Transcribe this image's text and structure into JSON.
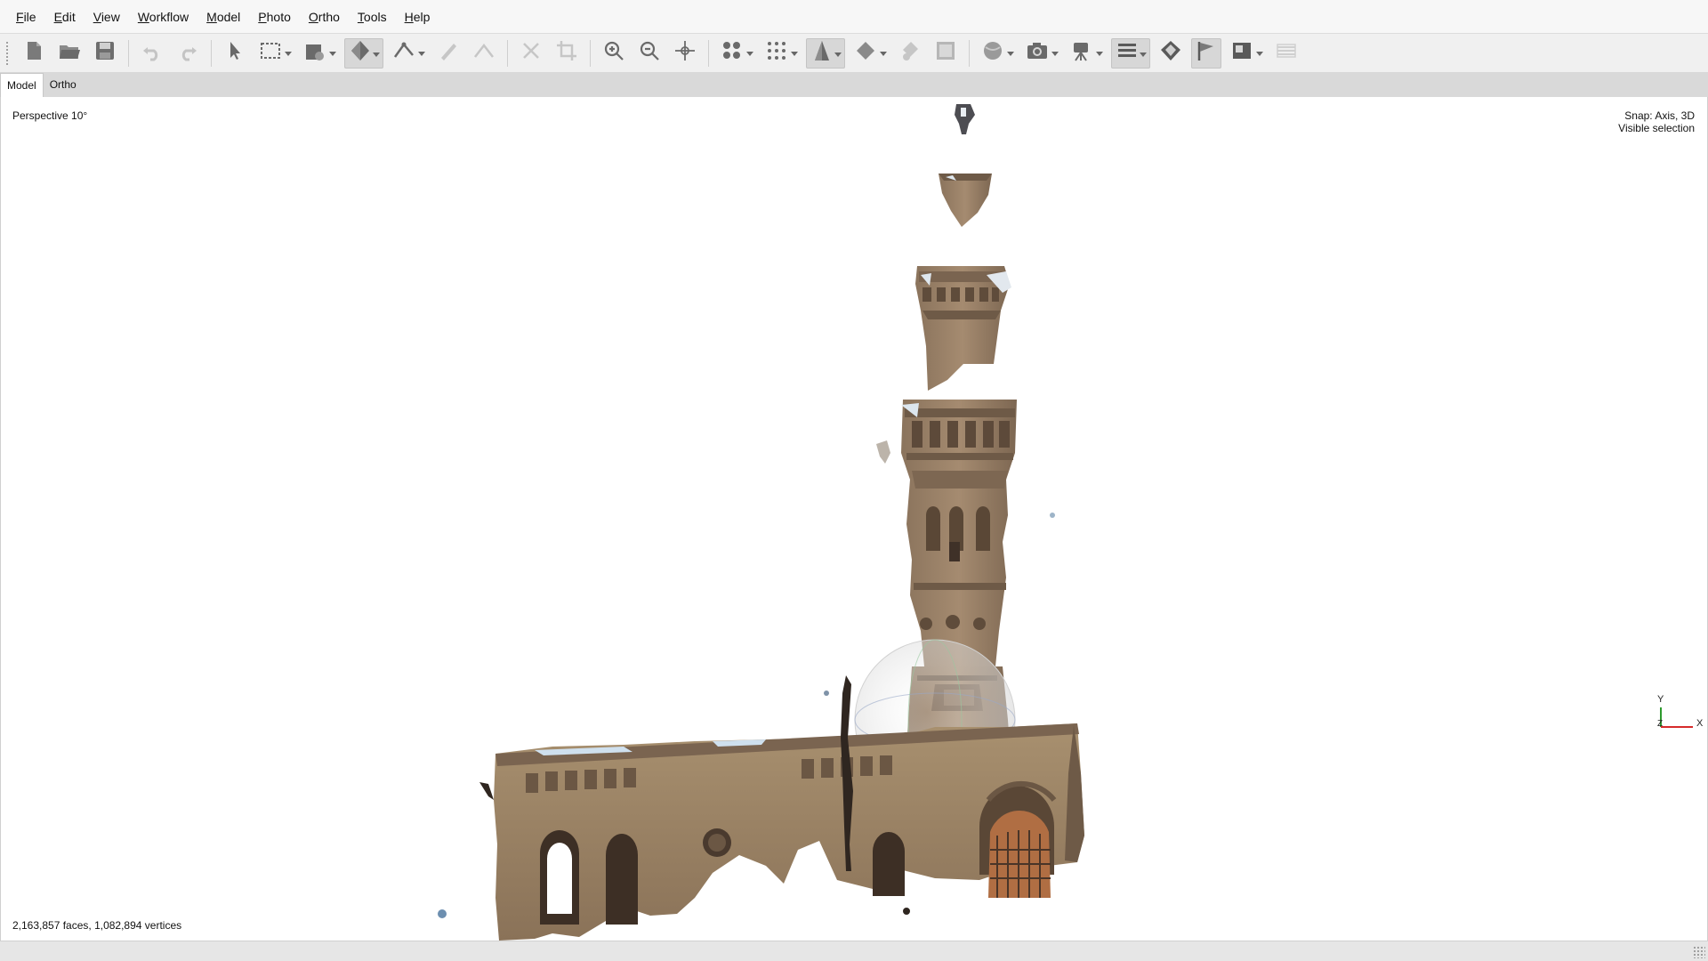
{
  "menu": [
    {
      "key": "F",
      "rest": "ile"
    },
    {
      "key": "E",
      "rest": "dit"
    },
    {
      "key": "V",
      "rest": "iew"
    },
    {
      "key": "W",
      "rest": "orkflow"
    },
    {
      "key": "M",
      "rest": "odel"
    },
    {
      "key": "P",
      "rest": "hoto"
    },
    {
      "key": "O",
      "rest": "rtho"
    },
    {
      "key": "T",
      "rest": "ools"
    },
    {
      "key": "H",
      "rest": "elp"
    }
  ],
  "toolbar_icons": [
    "new-project-icon",
    "open-project-icon",
    "save-project-icon",
    "undo-icon",
    "redo-icon",
    "navigation-arrow-icon",
    "rectangle-selection-icon",
    "draw-shape-icon",
    "model-view-icon",
    "measure-ruler-icon",
    "draw-line-icon",
    "polyline-icon",
    "delete-selection-icon",
    "crop-selection-icon",
    "zoom-in-icon",
    "zoom-out-icon",
    "move-object-icon",
    "point-cloud-icon",
    "dense-cloud-icon",
    "mesh-shaded-icon",
    "solid-model-icon",
    "texture-icon",
    "tiled-model-icon",
    "show-cameras-icon",
    "screenshot-camera-icon",
    "camera-track-icon",
    "layers-menu-icon",
    "shapes-icon",
    "markers-flag-icon",
    "ortho-image-icon",
    "grid-icon"
  ],
  "tabs": [
    {
      "label": "Model",
      "active": true
    },
    {
      "label": "Ortho",
      "active": false
    }
  ],
  "viewport": {
    "perspective": "Perspective 10°",
    "snap_line1": "Snap: Axis, 3D",
    "snap_line2": "Visible selection",
    "stats": "2,163,857 faces, 1,082,894 vertices",
    "axes": {
      "y": "Y",
      "z": "Z",
      "x": "X"
    }
  },
  "colors": {
    "stone": "#9b8167",
    "stone_dark": "#6e5a47",
    "stone_light": "#b9a288",
    "axis_x": "#d62b2b",
    "axis_y": "#2e9a2e"
  }
}
